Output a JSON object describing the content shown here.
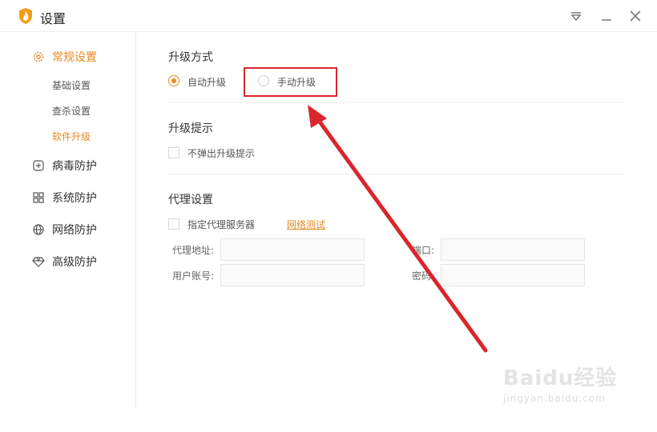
{
  "window": {
    "title": "设置"
  },
  "sidebar": {
    "groups": [
      {
        "label": "常规设置",
        "icon": "gear-icon"
      },
      {
        "label": "病毒防护",
        "icon": "plus-box-icon"
      },
      {
        "label": "系统防护",
        "icon": "grid-icon"
      },
      {
        "label": "网络防护",
        "icon": "globe-icon"
      },
      {
        "label": "高级防护",
        "icon": "diamond-icon"
      }
    ],
    "sub_items": [
      "基础设置",
      "查杀设置",
      "软件升级"
    ],
    "active_group": "常规设置",
    "active_sub": "软件升级"
  },
  "upgrade_mode": {
    "title": "升级方式",
    "options": [
      {
        "label": "自动升级",
        "checked": true
      },
      {
        "label": "手动升级",
        "checked": false
      }
    ]
  },
  "upgrade_prompt": {
    "title": "升级提示",
    "checkbox_label": "不弹出升级提示",
    "checked": false
  },
  "proxy": {
    "title": "代理设置",
    "checkbox_label": "指定代理服务器",
    "checked": false,
    "test_link": "网络测试",
    "fields": {
      "address_label": "代理地址:",
      "port_label": "端口:",
      "account_label": "用户账号:",
      "password_label": "密码:"
    }
  },
  "watermark": {
    "brand": "Baidu经验",
    "url": "jingyan.baidu.com"
  },
  "colors": {
    "accent": "#e8871e",
    "annotation": "#d9262d"
  }
}
